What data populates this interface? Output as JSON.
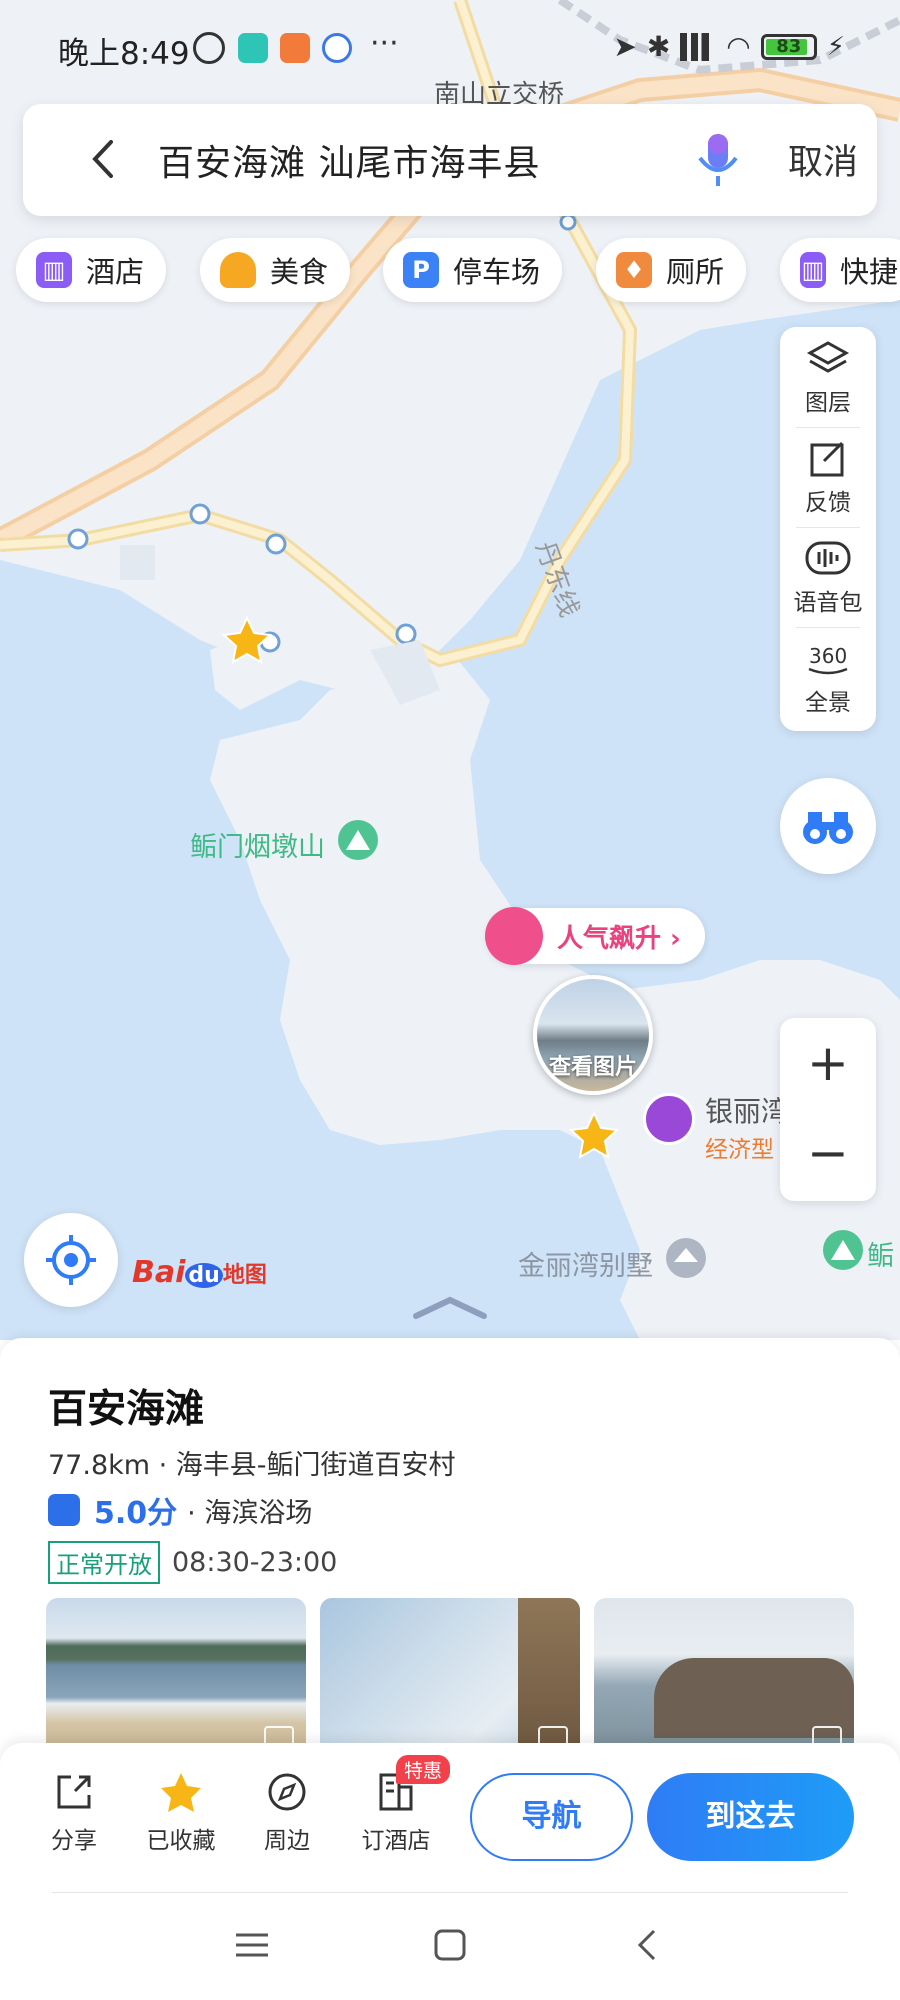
{
  "status_bar": {
    "time": "晚上8:49",
    "more": "···",
    "battery": "83"
  },
  "search": {
    "query": "百安海滩 汕尾市海丰县",
    "cancel_label": "取消"
  },
  "categories": [
    {
      "label": "酒店",
      "icon": "hotel-icon",
      "color": "#8b5cf6"
    },
    {
      "label": "美食",
      "icon": "food-icon",
      "color": "#f7a823"
    },
    {
      "label": "停车场",
      "icon": "parking-icon",
      "color": "#3b82f6"
    },
    {
      "label": "厕所",
      "icon": "toilet-icon",
      "color": "#f08a3e"
    },
    {
      "label": "快捷",
      "icon": "budget-hotel-icon",
      "color": "#8b5cf6"
    }
  ],
  "tools": {
    "layers": "图层",
    "feedback": "反馈",
    "voice_pack": "语音包",
    "panorama": "全景"
  },
  "map": {
    "road_label_top": "南山立交桥",
    "road_label_dandong": "丹东线",
    "mountain_label": "鲘门烟墩山",
    "popularity_label": "人气飙升 ›",
    "photo_label": "查看图片",
    "hotel_name": "银丽湾",
    "hotel_type": "经济型",
    "villa_label": "金丽湾别墅",
    "edge_label": "鲘",
    "zoom_in": "+",
    "zoom_out": "−",
    "logo_bai": "Bai",
    "logo_du": "du",
    "logo_map": "地图"
  },
  "poi": {
    "name": "百安海滩",
    "address": "77.8km · 海丰县-鲘门街道百安村",
    "score": "5.0分",
    "category": "· 海滨浴场",
    "open_status": "正常开放",
    "hours": "08:30-23:00"
  },
  "actions": {
    "share": "分享",
    "favorited": "已收藏",
    "nearby": "周边",
    "book_hotel": "订酒店",
    "deal_badge": "特惠",
    "navigate": "导航",
    "go_here": "到这去"
  },
  "colors": {
    "accent": "#2f7cf6",
    "sea": "#cfe3f8",
    "land": "#eef2f7",
    "road": "#fbe6c4",
    "open_green": "#17a07a",
    "popular_pink": "#e8427f"
  }
}
